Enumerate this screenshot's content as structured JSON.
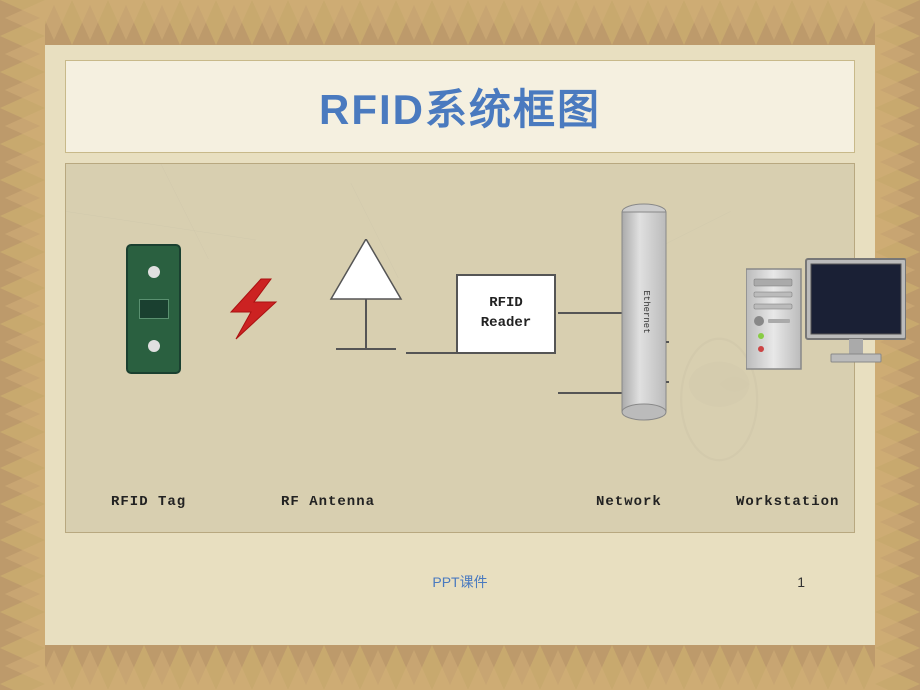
{
  "page": {
    "title": "RFID系统框图",
    "footer_text": "PPT课件",
    "page_number": "1",
    "bg_color": "#c8b98a",
    "accent_color": "#4a7abf"
  },
  "diagram": {
    "components": [
      {
        "id": "rfid-tag",
        "label": "RFID Tag"
      },
      {
        "id": "rf-antenna",
        "label": "RF Antenna"
      },
      {
        "id": "rfid-reader",
        "label": "RFID\nReader"
      },
      {
        "id": "network",
        "label": "Network"
      },
      {
        "id": "workstation",
        "label": "Workstation"
      }
    ],
    "reader_label_line1": "RFID",
    "reader_label_line2": "Reader",
    "ethernet_label": "Ethernet"
  }
}
